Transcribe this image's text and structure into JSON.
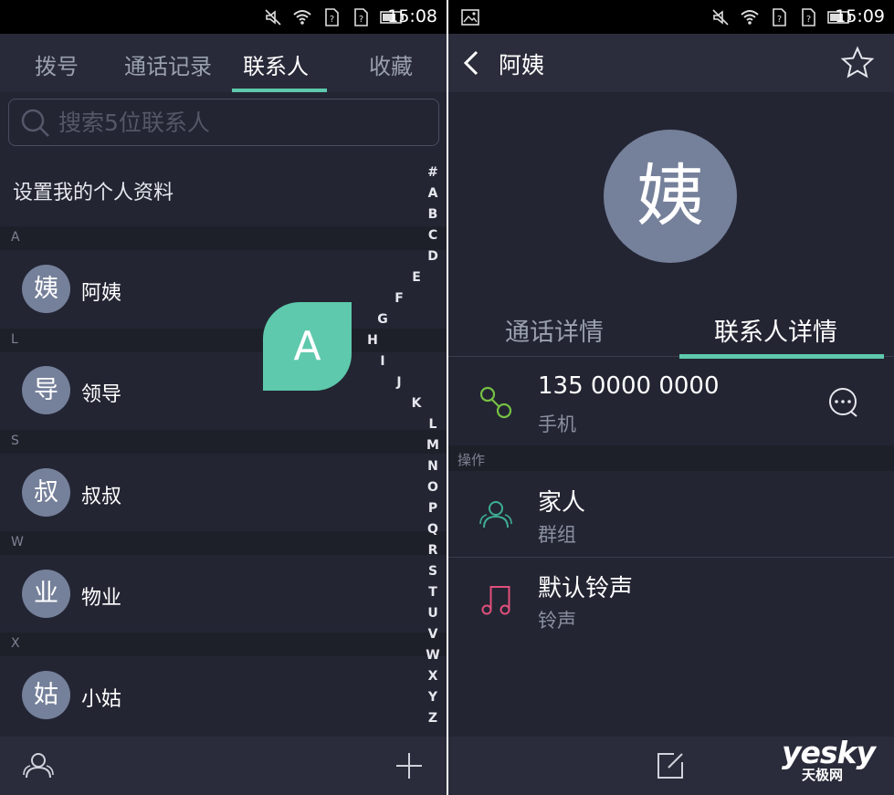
{
  "left_screen": {
    "status": {
      "time": "15:08"
    },
    "tabs": [
      {
        "label": "拨号"
      },
      {
        "label": "通话记录"
      },
      {
        "label": "联系人"
      },
      {
        "label": "收藏"
      }
    ],
    "active_tab": "联系人",
    "search": {
      "placeholder": "搜索5位联系人"
    },
    "profile_setup": "设置我的个人资料",
    "sections": [
      {
        "letter": "A",
        "contacts": [
          {
            "avatar": "姨",
            "name": "阿姨"
          }
        ]
      },
      {
        "letter": "L",
        "contacts": [
          {
            "avatar": "导",
            "name": "领导"
          }
        ]
      },
      {
        "letter": "S",
        "contacts": [
          {
            "avatar": "叔",
            "name": "叔叔"
          }
        ]
      },
      {
        "letter": "W",
        "contacts": [
          {
            "avatar": "业",
            "name": "物业"
          }
        ]
      },
      {
        "letter": "X",
        "contacts": [
          {
            "avatar": "姑",
            "name": "小姑"
          }
        ]
      }
    ],
    "index_bubble": "A",
    "alphabet_index": [
      "#",
      "A",
      "B",
      "C",
      "D",
      "E",
      "F",
      "G",
      "H",
      "I",
      "J",
      "K",
      "L",
      "M",
      "N",
      "O",
      "P",
      "Q",
      "R",
      "S",
      "T",
      "U",
      "V",
      "W",
      "X",
      "Y",
      "Z"
    ],
    "bottom_icons": [
      "contacts-group-icon",
      "plus-icon"
    ]
  },
  "right_screen": {
    "status": {
      "time": "15:09"
    },
    "header": {
      "title": "阿姨"
    },
    "avatar": "姨",
    "tabs": [
      {
        "label": "通话详情"
      },
      {
        "label": "联系人详情"
      }
    ],
    "active_tab": "联系人详情",
    "phone": {
      "number": "135 0000 0000",
      "type": "手机"
    },
    "operations_label": "操作",
    "group": {
      "value": "家人",
      "label": "群组"
    },
    "ringtone": {
      "value": "默认铃声",
      "label": "铃声"
    },
    "bottom_icons": [
      "edit-icon"
    ]
  },
  "watermark": {
    "main": "yesky",
    "sub": "天极网"
  },
  "colors": {
    "background": "#232533",
    "accent": "#5ec9ac",
    "avatar": "#75809a",
    "phone_icon": "#76c043",
    "group_icon": "#3fae92",
    "ringtone_icon": "#e0507a"
  }
}
